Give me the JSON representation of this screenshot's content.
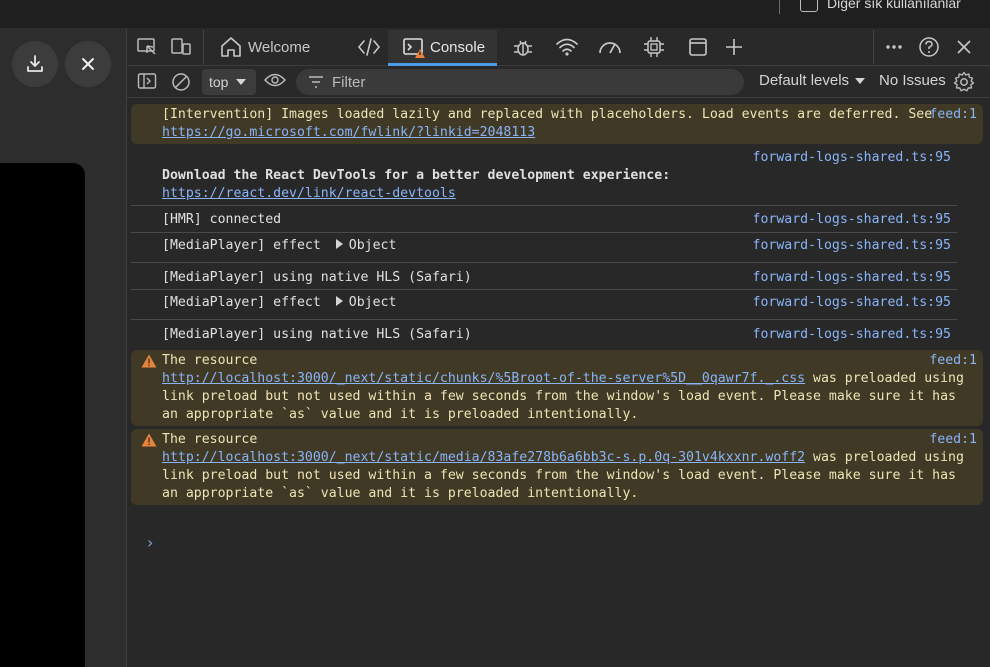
{
  "favorites_bar": {
    "item_label": "Diğer sık kullanılanlar"
  },
  "tabs": [
    {
      "label": "Welcome",
      "icon": "home-icon"
    },
    {
      "label": "Console",
      "icon": "console-icon"
    }
  ],
  "toolbar": {
    "context": "top",
    "filter_placeholder": "Filter",
    "levels": "Default levels",
    "issues": "No Issues"
  },
  "messages": [
    {
      "type": "warn",
      "text": "[Intervention] Images loaded lazily and replaced with placeholders. Load events are deferred. See ",
      "link": "https://go.microsoft.com/fwlink/?linkid=2048113",
      "source": "feed:1"
    },
    {
      "type": "log",
      "text": "Download the React DevTools for a better development experience:",
      "link": "https://react.dev/link/react-devtools",
      "source": "forward-logs-shared.ts:95"
    },
    {
      "type": "log",
      "text": "[HMR] connected",
      "source": "forward-logs-shared.ts:95"
    },
    {
      "type": "log",
      "text": "[MediaPlayer] effect",
      "object": "Object",
      "source": "forward-logs-shared.ts:95"
    },
    {
      "type": "log",
      "text": "[MediaPlayer] using native HLS (Safari)",
      "source": "forward-logs-shared.ts:95"
    },
    {
      "type": "log",
      "text": "[MediaPlayer] effect",
      "object": "Object",
      "source": "forward-logs-shared.ts:95"
    },
    {
      "type": "log",
      "text": "[MediaPlayer] using native HLS (Safari)",
      "source": "forward-logs-shared.ts:95"
    },
    {
      "type": "warn",
      "text": "The resource",
      "link": "http://localhost:3000/_next/static/chunks/%5Broot-of-the-server%5D__0qawr7f._.css",
      "tail": " was preloaded using link preload but not used within a few seconds from the window's load event. Please make sure it has an appropriate `as` value and it is preloaded intentionally.",
      "source": "feed:1"
    },
    {
      "type": "warn",
      "text": "The resource",
      "link": "http://localhost:3000/_next/static/media/83afe278b6a6bb3c-s.p.0q-301v4kxxnr.woff2",
      "tail": " was preloaded using link preload but not used within a few seconds from the window's load event. Please make sure it has an appropriate `as` value and it is preloaded intentionally.",
      "source": "feed:1"
    }
  ],
  "prompt_symbol": "›",
  "colors": {
    "accent": "#4c9be8",
    "link": "#8ab4f8",
    "warn_bg": "#3f3926",
    "warn_icon": "#e8833a"
  }
}
